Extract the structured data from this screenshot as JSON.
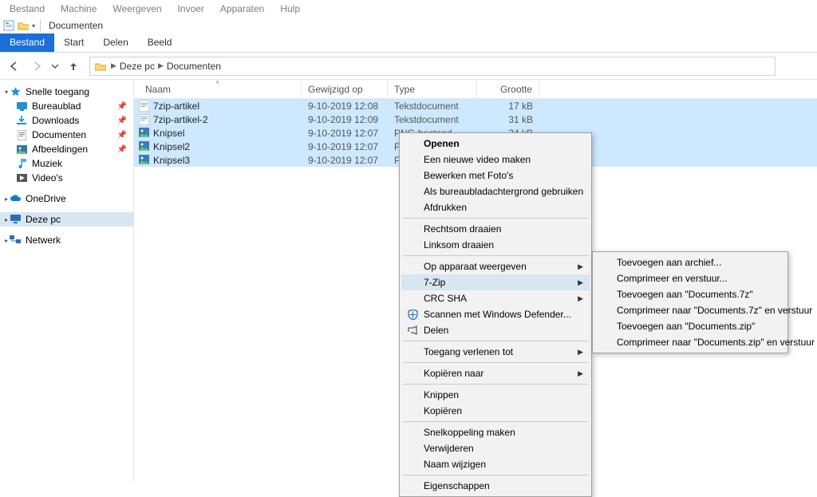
{
  "vm_menu": [
    "Bestand",
    "Machine",
    "Weergeven",
    "Invoer",
    "Apparaten",
    "Hulp"
  ],
  "window": {
    "title": "Documenten"
  },
  "ribbon": {
    "tabs": [
      "Bestand",
      "Start",
      "Delen",
      "Beeld"
    ],
    "active": 0
  },
  "breadcrumb": {
    "root": "Deze pc",
    "current": "Documenten"
  },
  "navpane": {
    "quick": {
      "label": "Snelle toegang"
    },
    "desktop": {
      "label": "Bureaublad"
    },
    "downloads": {
      "label": "Downloads"
    },
    "documents": {
      "label": "Documenten"
    },
    "pictures": {
      "label": "Afbeeldingen"
    },
    "music": {
      "label": "Muziek"
    },
    "videos": {
      "label": "Video's"
    },
    "onedrive": {
      "label": "OneDrive"
    },
    "thispc": {
      "label": "Deze pc"
    },
    "network": {
      "label": "Netwerk"
    }
  },
  "columns": {
    "name": "Naam",
    "modified": "Gewijzigd op",
    "type": "Type",
    "size": "Grootte"
  },
  "rows": [
    {
      "name": "7zip-artikel",
      "mod": "9-10-2019 12:08",
      "type": "Tekstdocument",
      "size": "17 kB",
      "icon": "txt"
    },
    {
      "name": "7zip-artikel-2",
      "mod": "9-10-2019 12:09",
      "type": "Tekstdocument",
      "size": "31 kB",
      "icon": "txt"
    },
    {
      "name": "Knipsel",
      "mod": "9-10-2019 12:07",
      "type": "PNG-bestand",
      "size": "24 kB",
      "icon": "png"
    },
    {
      "name": "Knipsel2",
      "mod": "9-10-2019 12:07",
      "type": "PNG-besta",
      "size": "",
      "icon": "png"
    },
    {
      "name": "Knipsel3",
      "mod": "9-10-2019 12:07",
      "type": "PNG-besta",
      "size": "",
      "icon": "png"
    }
  ],
  "ctx1": {
    "open": "Openen",
    "newvideo": "Een nieuwe video maken",
    "editphotos": "Bewerken met Foto's",
    "wallpaper": "Als bureaubladachtergrond gebruiken",
    "print": "Afdrukken",
    "rotR": "Rechtsom draaien",
    "rotL": "Linksom draaien",
    "cast": "Op apparaat weergeven",
    "sevenzip": "7-Zip",
    "crcsha": "CRC SHA",
    "defender": "Scannen met Windows Defender...",
    "share": "Delen",
    "access": "Toegang verlenen tot",
    "copyto": "Kopiëren naar",
    "cut": "Knippen",
    "copy": "Kopiëren",
    "shortcut": "Snelkoppeling maken",
    "delete": "Verwijderen",
    "rename": "Naam wijzigen",
    "props": "Eigenschappen"
  },
  "ctx2": {
    "add": "Toevoegen aan archief...",
    "compsend": "Comprimeer en verstuur...",
    "add7z": "Toevoegen aan \"Documents.7z\"",
    "comp7zsend": "Comprimeer naar \"Documents.7z\" en verstuur",
    "addzip": "Toevoegen aan \"Documents.zip\"",
    "compzipsend": "Comprimeer naar \"Documents.zip\" en verstuur"
  }
}
